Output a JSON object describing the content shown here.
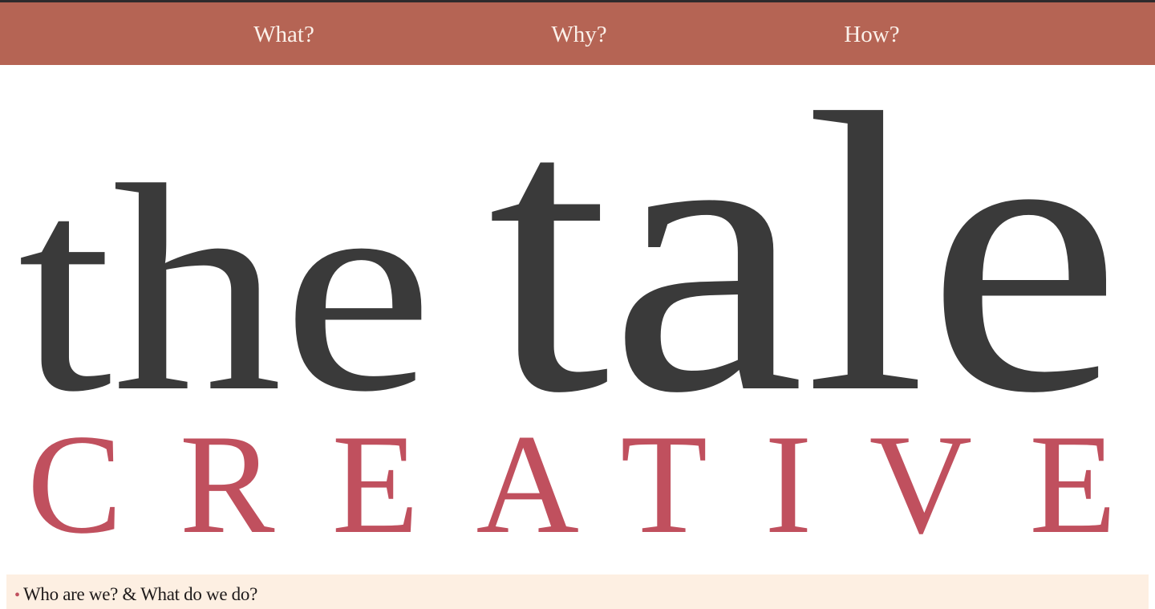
{
  "nav": {
    "items": [
      {
        "label": "What?"
      },
      {
        "label": "Why?"
      },
      {
        "label": "How?"
      }
    ]
  },
  "logo": {
    "word_the": "the",
    "word_tale": "tale",
    "word_creative": "CREATIVE",
    "colors": {
      "primary": "#3a3a3a",
      "accent": "#c0505e"
    }
  },
  "section": {
    "bullet": "•",
    "title": "Who are we? & What do we do?"
  },
  "colors": {
    "nav_bg": "#b56454",
    "nav_text": "#fbf1ea",
    "section_bg": "#fdefe2"
  }
}
